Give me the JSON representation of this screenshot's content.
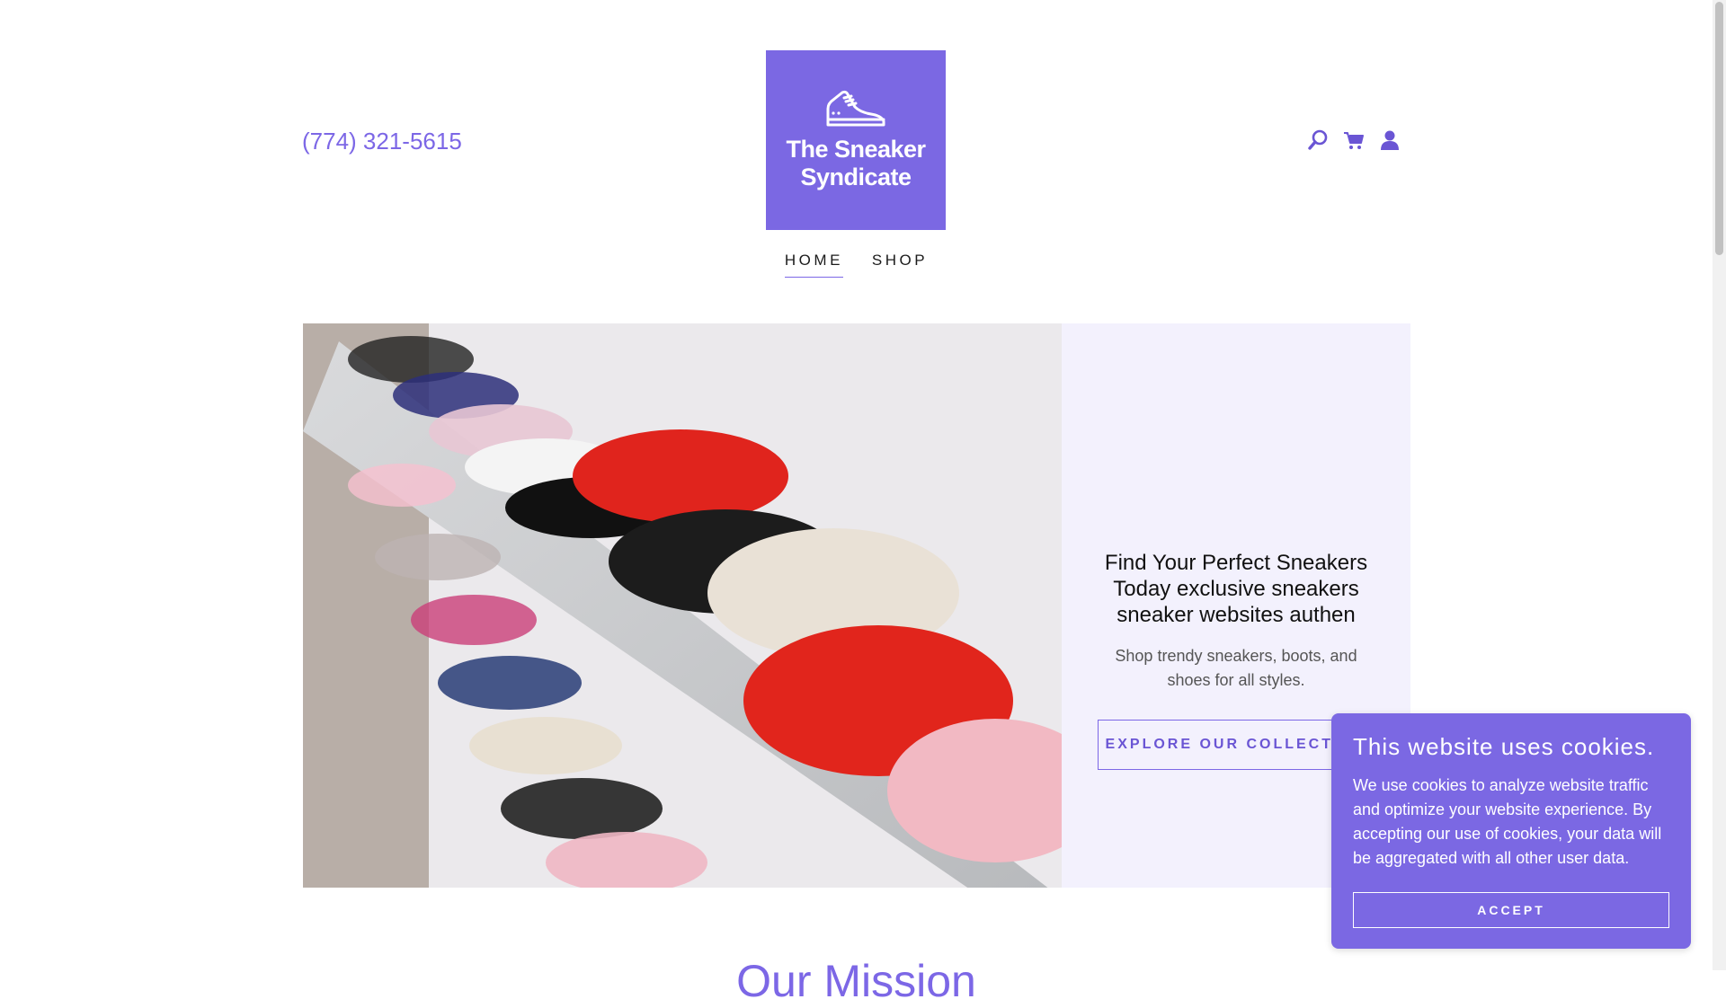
{
  "header": {
    "phone": "(774) 321-5615",
    "logo": {
      "line1": "The Sneaker",
      "line2": "Syndicate",
      "bg_color": "#7b68e3",
      "icon": "sneaker-icon"
    },
    "icons": [
      "search-icon",
      "cart-icon",
      "account-icon"
    ],
    "accent_color": "#7c67e6"
  },
  "nav": {
    "items": [
      {
        "label": "HOME",
        "active": true
      },
      {
        "label": "SHOP",
        "active": false
      }
    ]
  },
  "hero": {
    "image": "sneakers-on-shelf-photo",
    "heading": "Find Your Perfect Sneakers Today exclusive sneakers sneaker websites authen",
    "subheading": "Shop trendy sneakers, boots, and shoes for all styles.",
    "cta_label": "EXPLORE OUR COLLECTION",
    "panel_bg": "#f3f1fd"
  },
  "next_section": {
    "title_partial": "Our Mission"
  },
  "cookie_banner": {
    "title": "This website uses cookies.",
    "body": "We use cookies to analyze website traffic and optimize your website experience. By accepting our use of cookies, your data will be aggregated with all other user data.",
    "accept_label": "ACCEPT"
  }
}
